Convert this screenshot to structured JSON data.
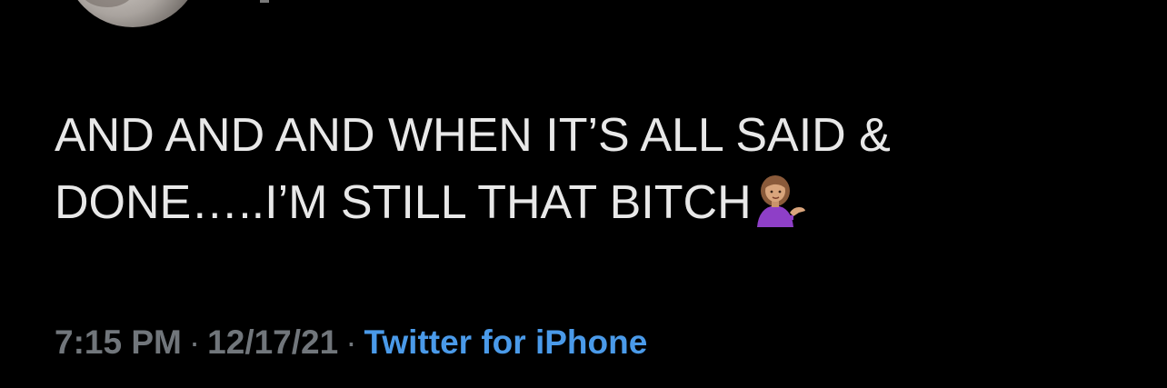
{
  "tweet": {
    "text_line_1": "AND AND AND WHEN IT’S ALL SAID &",
    "text_line_2": "DONE…..I’M STILL THAT BITCH",
    "emoji_icon": "person-tipping-hand-icon",
    "time": "7:15 PM",
    "separator": "·",
    "date": "12/17/21",
    "source": "Twitter for iPhone"
  },
  "colors": {
    "background": "#000000",
    "text": "#e8e8e8",
    "meta": "#71767b",
    "link": "#4a9ae9"
  }
}
